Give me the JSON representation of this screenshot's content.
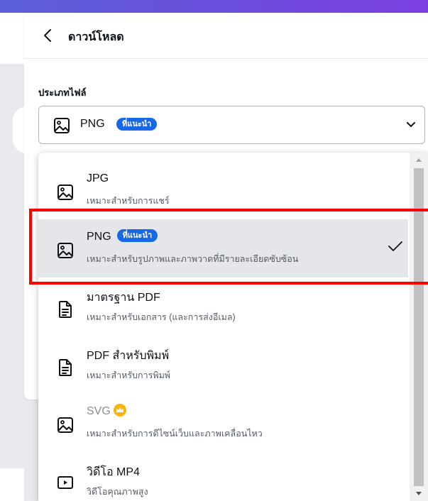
{
  "header": {
    "title": "ดาวน์โหลด"
  },
  "file_type": {
    "label": "ประเภทไฟล์",
    "selected": "PNG",
    "selected_badge": "ที่แนะนำ"
  },
  "options": [
    {
      "title": "JPG",
      "subtitle": "เหมาะสำหรับการแชร์",
      "icon": "image-icon"
    },
    {
      "title": "PNG",
      "badge": "ที่แนะนำ",
      "subtitle": "เหมาะสำหรับรูปภาพและภาพวาดที่มีรายละเอียดซับซ้อน",
      "icon": "image-icon",
      "selected": true
    },
    {
      "title": "มาตรฐาน PDF",
      "subtitle": "เหมาะสำหรับเอกสาร (และการส่งอีเมล)",
      "icon": "document-icon"
    },
    {
      "title": "PDF สำหรับพิมพ์",
      "subtitle": "เหมาะสำหรับการพิมพ์",
      "icon": "document-icon"
    },
    {
      "title": "SVG",
      "subtitle": "เหมาะสำหรับการดีไซน์เว็บและภาพเคลื่อนไหว",
      "icon": "image-icon",
      "premium": true
    },
    {
      "title": "วิดีโอ MP4",
      "subtitle": "วิดีโอคุณภาพสูง",
      "icon": "video-icon"
    }
  ],
  "colors": {
    "accent": "#1768e6",
    "highlight": "#ff0000",
    "premium": "#f5b50a",
    "topbar": "#5b5fd8"
  }
}
